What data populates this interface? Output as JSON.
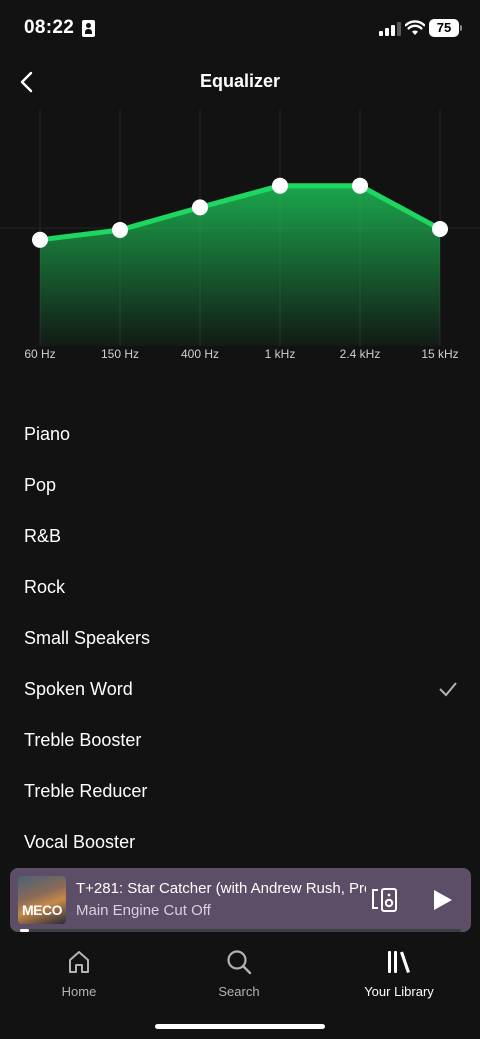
{
  "status_bar": {
    "time": "08:22",
    "battery": "75"
  },
  "header": {
    "title": "Equalizer"
  },
  "equalizer": {
    "bands": [
      "60 Hz",
      "150 Hz",
      "400 Hz",
      "1 kHz",
      "2.4 kHz",
      "15 kHz"
    ],
    "levels": [
      -1.2,
      -0.2,
      2.1,
      4.3,
      4.3,
      -0.1
    ],
    "range_db": [
      -12,
      12
    ],
    "accent_color": "#1ed760"
  },
  "presets": [
    {
      "label": "Piano",
      "selected": false
    },
    {
      "label": "Pop",
      "selected": false
    },
    {
      "label": "R&B",
      "selected": false
    },
    {
      "label": "Rock",
      "selected": false
    },
    {
      "label": "Small Speakers",
      "selected": false
    },
    {
      "label": "Spoken Word",
      "selected": true
    },
    {
      "label": "Treble Booster",
      "selected": false
    },
    {
      "label": "Treble Reducer",
      "selected": false
    },
    {
      "label": "Vocal Booster",
      "selected": false
    }
  ],
  "mini_player": {
    "art_text": "MECO",
    "title": "T+281: Star Catcher (with Andrew Rush, Pre",
    "artist": "Main Engine Cut Off",
    "progress": 0.02,
    "background_color": "#5b4e66"
  },
  "tabs": [
    {
      "label": "Home",
      "icon": "home-icon",
      "active": false
    },
    {
      "label": "Search",
      "icon": "search-icon",
      "active": false
    },
    {
      "label": "Your Library",
      "icon": "library-icon",
      "active": true
    }
  ]
}
